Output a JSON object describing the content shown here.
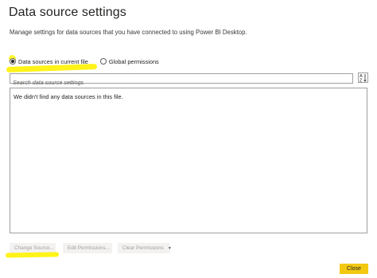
{
  "dialog": {
    "title": "Data source settings",
    "subtitle": "Manage settings for data sources that you have connected to using Power BI Desktop."
  },
  "scope": {
    "options": [
      {
        "label": "Data sources in current file",
        "selected": true
      },
      {
        "label": "Global permissions",
        "selected": false
      }
    ]
  },
  "search": {
    "placeholder": "Search data source settings"
  },
  "sort": {
    "icon": "sort-az-icon",
    "top": "A",
    "bottom": "Z"
  },
  "list": {
    "empty_message": "We didn't find any data sources in this file."
  },
  "actions": {
    "change_source": "Change Source...",
    "edit_permissions": "Edit Permissions...",
    "clear_permissions": "Clear Permissions",
    "clear_caret": "▼"
  },
  "footer": {
    "close": "Close"
  },
  "colors": {
    "accent": "#f2c811",
    "highlight": "#fff200",
    "border": "#a19f9d"
  }
}
